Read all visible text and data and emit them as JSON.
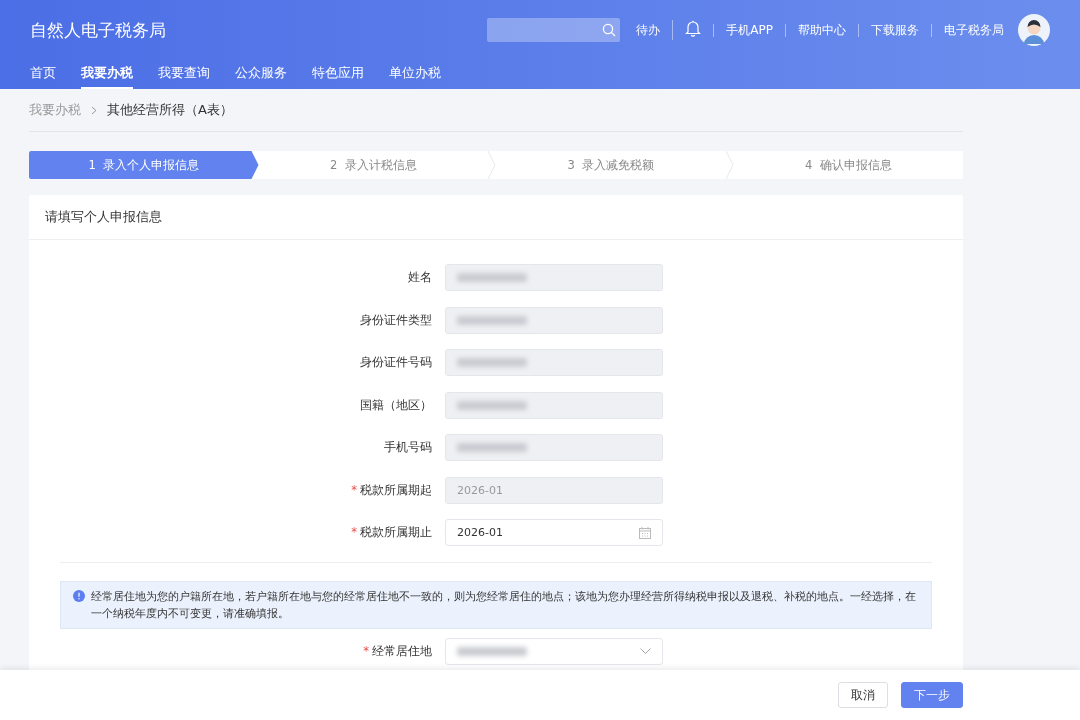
{
  "header": {
    "title": "自然人电子税务局",
    "links": [
      {
        "kind": "text",
        "label": "待办"
      },
      {
        "kind": "bell"
      },
      {
        "kind": "text",
        "label": "手机APP"
      },
      {
        "kind": "text",
        "label": "帮助中心"
      },
      {
        "kind": "text",
        "label": "下载服务"
      },
      {
        "kind": "text",
        "label": "电子税务局"
      }
    ]
  },
  "nav": [
    {
      "label": "首页",
      "selected": false
    },
    {
      "label": "我要办税",
      "selected": true
    },
    {
      "label": "我要查询",
      "selected": false
    },
    {
      "label": "公众服务",
      "selected": false
    },
    {
      "label": "特色应用",
      "selected": false
    },
    {
      "label": "单位办税",
      "selected": false
    }
  ],
  "breadcrumb": [
    "我要办税",
    "其他经营所得（A表）"
  ],
  "steps": [
    {
      "label": "1  录入个人申报信息",
      "selected": true
    },
    {
      "label": "2  录入计税信息",
      "selected": false
    },
    {
      "label": "3  录入减免税额",
      "selected": false
    },
    {
      "label": "4  确认申报信息",
      "selected": false
    }
  ],
  "card": {
    "title": "请填写个人申报信息",
    "fields": [
      {
        "label": "姓名",
        "kind": "text",
        "disabled": true,
        "redacted": true
      },
      {
        "label": "身份证件类型",
        "kind": "text",
        "disabled": true,
        "redacted": true
      },
      {
        "label": "身份证件号码",
        "kind": "text",
        "disabled": true,
        "redacted": true
      },
      {
        "label": "国籍（地区）",
        "kind": "text",
        "disabled": true,
        "redacted": true
      },
      {
        "label": "手机号码",
        "kind": "text",
        "disabled": true,
        "redacted": true
      },
      {
        "required_mark": "*",
        "label": "税款所属期起",
        "kind": "text",
        "disabled": true,
        "value": "2026-01"
      },
      {
        "required_mark": "*",
        "label": "税款所属期止",
        "kind": "date",
        "disabled": false,
        "value": "2026-01"
      }
    ],
    "notice": "经常居住地为您的户籍所在地，若户籍所在地与您的经常居住地不一致的，则为您经常居住的地点；该地为您办理经营所得纳税申报以及退税、补税的地点。一经选择，在一个纳税年度内不可变更，请准确填报。",
    "residence": {
      "required_mark": "*",
      "label": "经常居住地",
      "kind": "select",
      "disabled": false,
      "redacted": true
    }
  },
  "footer": {
    "buttons": [
      {
        "label": "取消",
        "kind": "secondary"
      },
      {
        "label": "下一步",
        "kind": "primary"
      }
    ]
  }
}
